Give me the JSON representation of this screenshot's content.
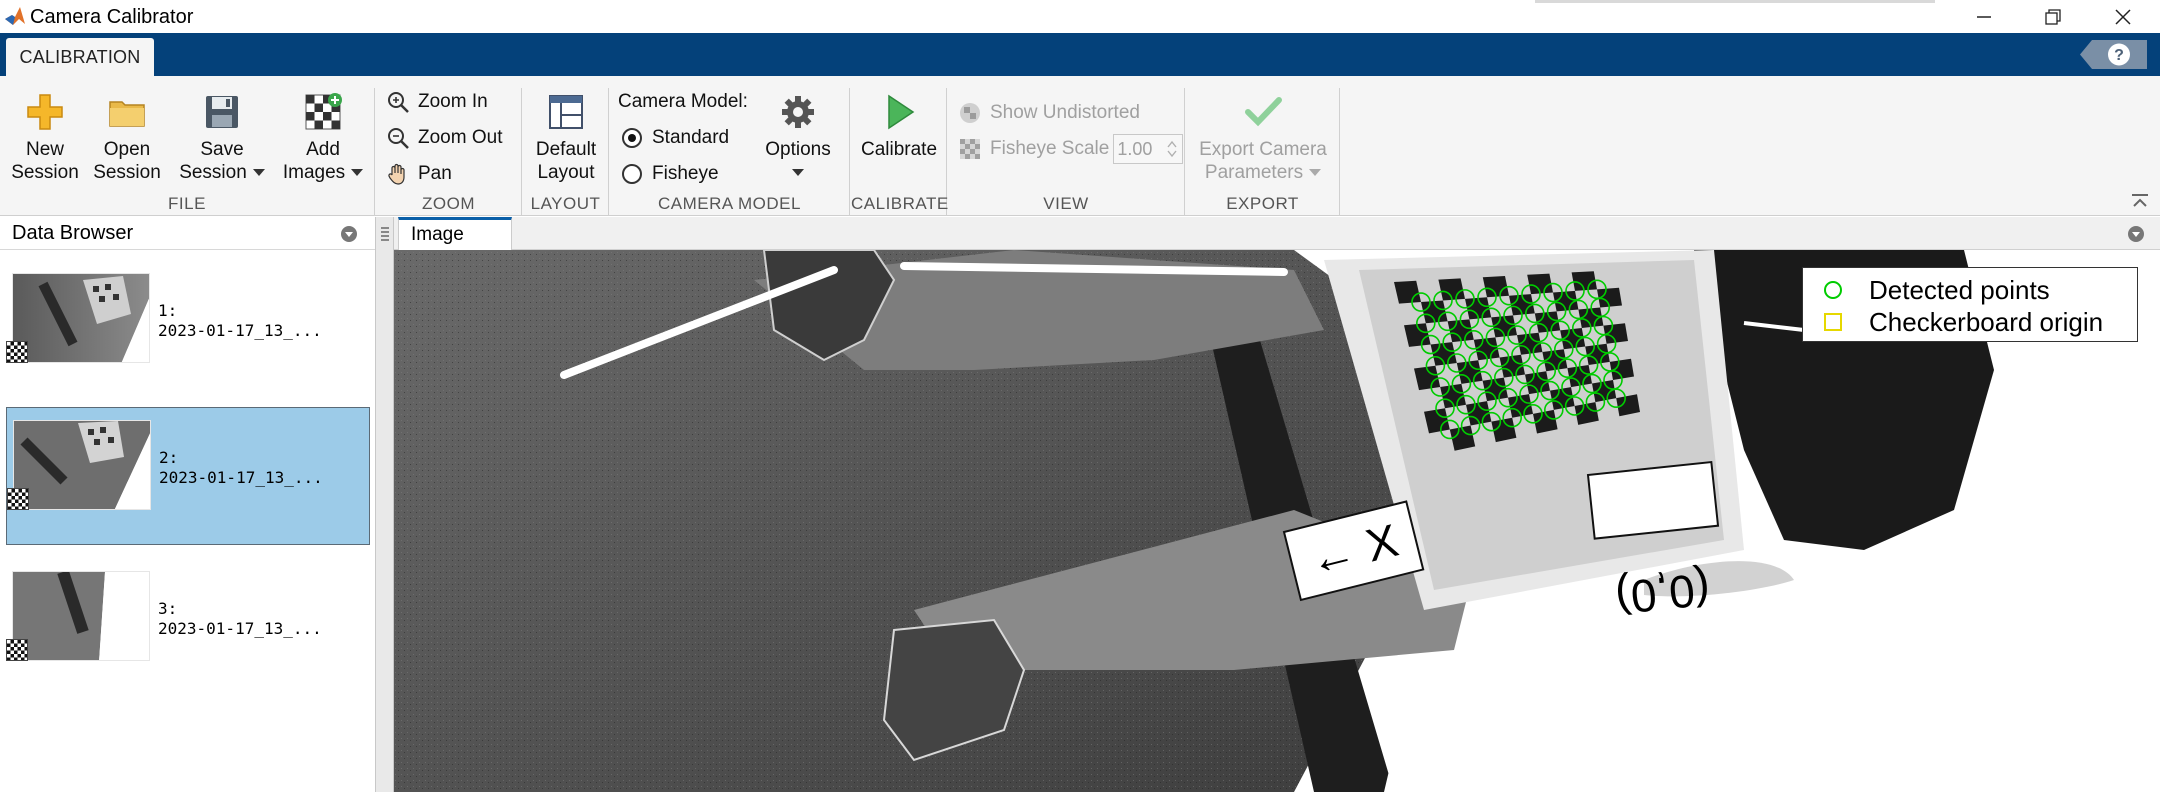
{
  "window": {
    "title": "Camera Calibrator",
    "controls": {
      "minimize": "minimize-icon",
      "restore": "restore-icon",
      "close": "close-icon"
    }
  },
  "tabs": {
    "active": "CALIBRATION",
    "help": "?"
  },
  "ribbon": {
    "file": {
      "label": "FILE",
      "new_session": {
        "line1": "New",
        "line2": "Session"
      },
      "open_session": {
        "line1": "Open",
        "line2": "Session"
      },
      "save_session": {
        "line1": "Save",
        "line2": "Session"
      },
      "add_images": {
        "line1": "Add",
        "line2": "Images"
      }
    },
    "zoom": {
      "label": "ZOOM",
      "zoom_in": "Zoom In",
      "zoom_out": "Zoom Out",
      "pan": "Pan"
    },
    "layout": {
      "label": "LAYOUT",
      "default_layout": {
        "line1": "Default",
        "line2": "Layout"
      }
    },
    "camera_model": {
      "label": "CAMERA MODEL",
      "heading": "Camera Model:",
      "standard": "Standard",
      "fisheye": "Fisheye",
      "selected": "Standard",
      "options": "Options"
    },
    "calibrate": {
      "label": "CALIBRATE",
      "button": "Calibrate"
    },
    "view": {
      "label": "VIEW",
      "show_undistorted": "Show Undistorted",
      "fisheye_scale": "Fisheye Scale",
      "fisheye_scale_value": "1.00"
    },
    "export": {
      "label": "EXPORT",
      "line1": "Export Camera",
      "line2": "Parameters"
    }
  },
  "data_browser": {
    "title": "Data Browser",
    "items": [
      {
        "index": "1:",
        "name": "2023-01-17_13_...",
        "selected": false
      },
      {
        "index": "2:",
        "name": "2023-01-17_13_...",
        "selected": true
      },
      {
        "index": "3:",
        "name": "2023-01-17_13_...",
        "selected": false
      }
    ]
  },
  "image_panel": {
    "tab": "Image",
    "legend": [
      {
        "label": "Detected points",
        "marker": "circle",
        "color": "#00cc00"
      },
      {
        "label": "Checkerboard origin",
        "marker": "square",
        "color": "#e6d800"
      }
    ],
    "annotations": {
      "x_axis": "← X",
      "origin": "(0,0)"
    }
  },
  "colors": {
    "accent": "#04417a",
    "selection": "#9ccbe8",
    "detected": "#00cc00",
    "origin": "#e6d800",
    "calibrate_green": "#3aa64b"
  }
}
